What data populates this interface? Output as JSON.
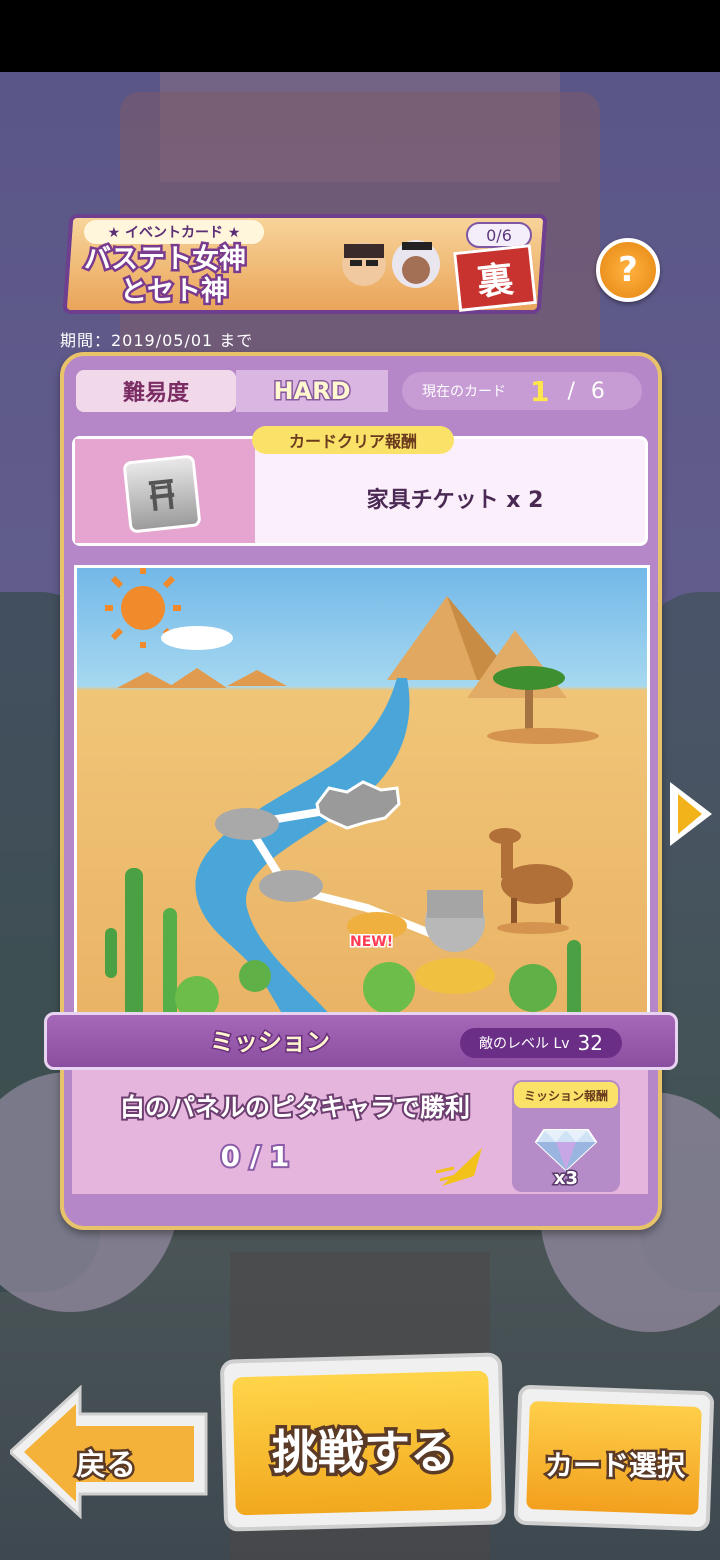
{
  "event": {
    "tag": "★ イベントカード ★",
    "title_line1": "バステト女神",
    "title_line2": "とセト神",
    "progress": "0/6",
    "stamp": "裏",
    "period": "期間：2019/05/01 まで"
  },
  "help": {
    "icon": "?"
  },
  "difficulty": {
    "label": "難易度",
    "value": "HARD",
    "current_card_label": "現在のカード",
    "current_card": "1",
    "separator": "/",
    "total_cards": "6"
  },
  "card_reward": {
    "tag": "カードクリア報酬",
    "icon": "chair-ticket-icon",
    "text": "家具チケット x 2"
  },
  "map": {
    "new_badge": "NEW!"
  },
  "mission": {
    "title": "ミッション",
    "enemy_level_label": "敵のレベル Lv",
    "enemy_level": "32",
    "description": "白のパネルのピタキャラで勝利",
    "progress": "0 / 1",
    "reward_label": "ミッション報酬",
    "reward_icon": "diamond-icon",
    "reward_count": "x3"
  },
  "buttons": {
    "back": "戻る",
    "challenge": "挑戦する",
    "card_select": "カード選択"
  },
  "colors": {
    "panel": "#b687c8",
    "gold_border": "#e8c36a",
    "accent_yellow": "#ffe64a"
  }
}
